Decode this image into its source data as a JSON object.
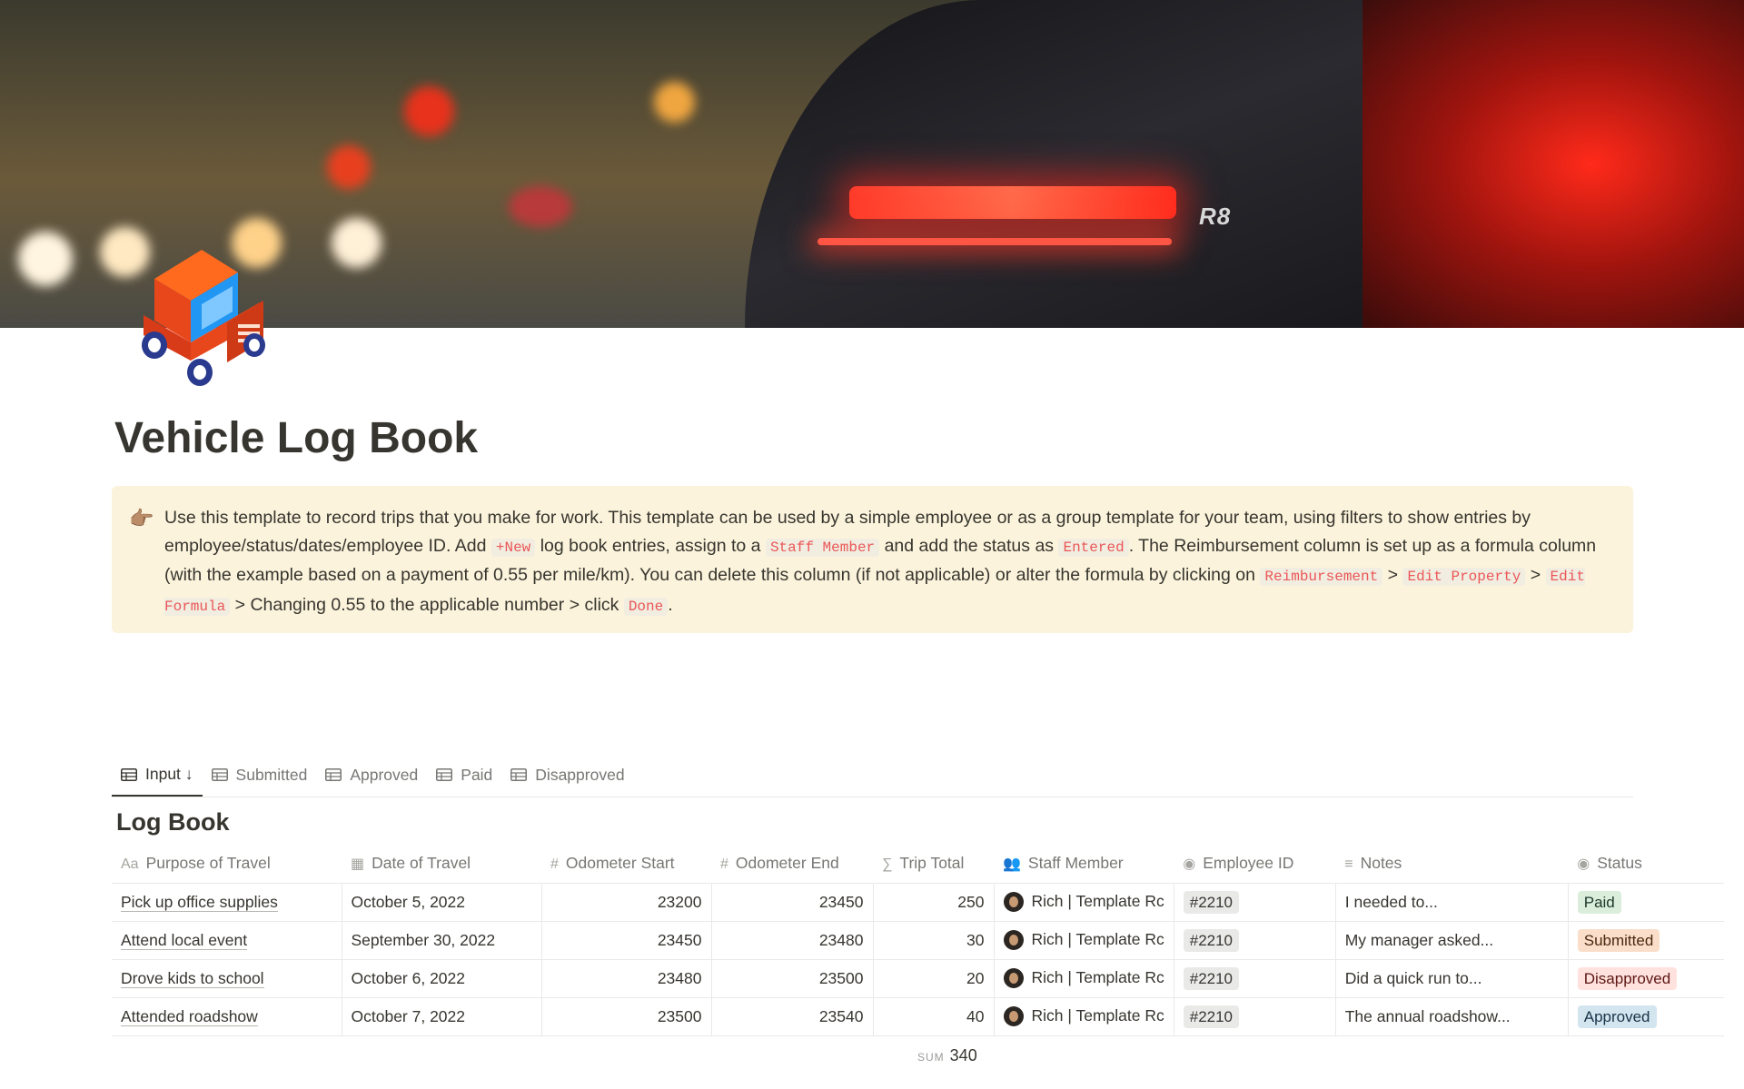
{
  "page": {
    "title": "Vehicle Log Book",
    "cover_badge": "R8"
  },
  "callout": {
    "icon": "👉🏽",
    "text_1": "Use this template to record trips that you make for work. This template can be used by a simple employee or as a group template for your team, using filters to show entries by employee/status/dates/employee ID. Add ",
    "code_1": "+New",
    "text_2": " log book entries, assign to a ",
    "code_2": "Staff Member",
    "text_3": " and add the status as ",
    "code_3": "Entered",
    "text_4": ". The Reimbursement column is set up as a formula column (with the example based on a payment of 0.55 per mile/km). You can delete this column (if not applicable) or alter the formula by clicking on ",
    "code_4": "Reimbursement",
    "text_5": " > ",
    "code_5": "Edit Property",
    "text_6": " > ",
    "code_6": "Edit Formula",
    "text_7": " > Changing 0.55 to the applicable number > click ",
    "code_7": "Done",
    "text_8": "."
  },
  "tabs": [
    {
      "label": "Input ↓",
      "active": true
    },
    {
      "label": "Submitted",
      "active": false
    },
    {
      "label": "Approved",
      "active": false
    },
    {
      "label": "Paid",
      "active": false
    },
    {
      "label": "Disapproved",
      "active": false
    }
  ],
  "database": {
    "title": "Log Book",
    "columns": [
      {
        "icon": "Aa",
        "label": "Purpose of Travel"
      },
      {
        "icon": "▦",
        "label": "Date of Travel"
      },
      {
        "icon": "#",
        "label": "Odometer Start"
      },
      {
        "icon": "#",
        "label": "Odometer End"
      },
      {
        "icon": "∑",
        "label": "Trip Total"
      },
      {
        "icon": "👥",
        "label": "Staff Member"
      },
      {
        "icon": "◉",
        "label": "Employee ID"
      },
      {
        "icon": "≡",
        "label": "Notes"
      },
      {
        "icon": "◉",
        "label": "Status"
      }
    ],
    "rows": [
      {
        "purpose": "Pick up office supplies",
        "date": "October 5, 2022",
        "start": "23200",
        "end": "23450",
        "total": "250",
        "staff": "Rich | Template Rc",
        "id": "#2210",
        "notes": "I needed to...",
        "status": "Paid"
      },
      {
        "purpose": "Attend local event",
        "date": "September 30, 2022",
        "start": "23450",
        "end": "23480",
        "total": "30",
        "staff": "Rich | Template Rc",
        "id": "#2210",
        "notes": "My manager asked...",
        "status": "Submitted"
      },
      {
        "purpose": "Drove kids to school",
        "date": "October 6, 2022",
        "start": "23480",
        "end": "23500",
        "total": "20",
        "staff": "Rich | Template Rc",
        "id": "#2210",
        "notes": "Did a quick run to...",
        "status": "Disapproved"
      },
      {
        "purpose": "Attended roadshow",
        "date": "October 7, 2022",
        "start": "23500",
        "end": "23540",
        "total": "40",
        "staff": "Rich | Template Rc",
        "id": "#2210",
        "notes": "The annual roadshow...",
        "status": "Approved"
      }
    ],
    "sum_label": "SUM",
    "sum_value": "340"
  },
  "status_colors": {
    "Paid": {
      "bg": "#dbeddb",
      "fg": "#1c3829"
    },
    "Submitted": {
      "bg": "#fadec9",
      "fg": "#49290e"
    },
    "Disapproved": {
      "bg": "#ffe2dd",
      "fg": "#5d1715"
    },
    "Approved": {
      "bg": "#d3e5ef",
      "fg": "#183347"
    }
  }
}
